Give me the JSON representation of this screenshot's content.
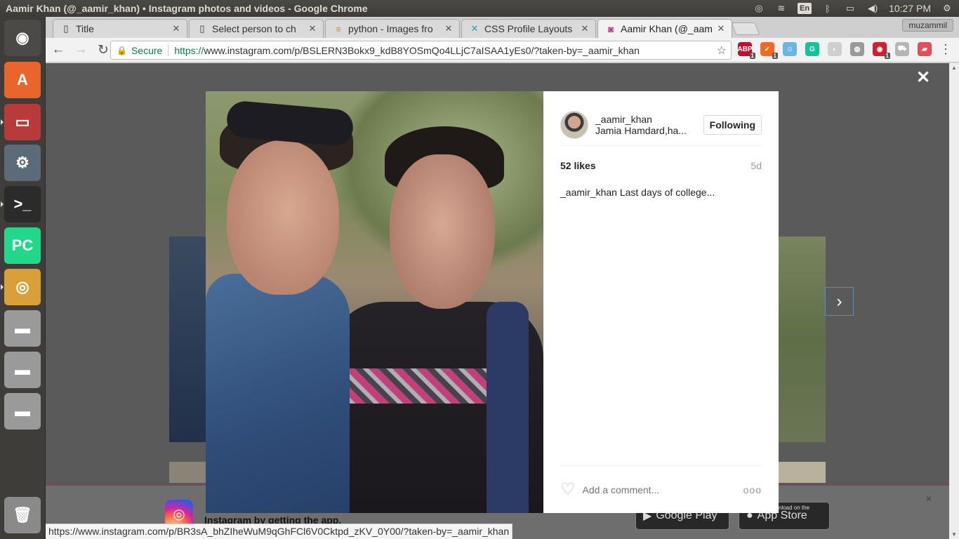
{
  "os": {
    "window_title": "Aamir Khan (@_aamir_khan) • Instagram photos and videos - Google Chrome",
    "lang": "En",
    "clock": "10:27 PM",
    "tray_icons": [
      "chrome-icon",
      "wifi-icon",
      "keyboard-lang",
      "bluetooth-icon",
      "battery-icon",
      "volume-icon",
      "clock",
      "settings-gear-icon"
    ]
  },
  "launcher": {
    "items": [
      {
        "name": "ubuntu-dash-icon",
        "glyph": "◉",
        "color": "#4b4a46"
      },
      {
        "name": "software-center-icon",
        "glyph": "A",
        "color": "#e8652b"
      },
      {
        "name": "file-manager-icon",
        "glyph": "▭",
        "color": "#b83a3a"
      },
      {
        "name": "system-settings-icon",
        "glyph": "⚙",
        "color": "#5c6b7a"
      },
      {
        "name": "terminal-icon",
        "glyph": ">_",
        "color": "#2b2b2b"
      },
      {
        "name": "pycharm-icon",
        "glyph": "PC",
        "color": "#21d789"
      },
      {
        "name": "chrome-icon",
        "glyph": "◎",
        "color": "#d9a03a"
      },
      {
        "name": "drive-icon-1",
        "glyph": "▬",
        "color": "#9a9a9a"
      },
      {
        "name": "drive-icon-2",
        "glyph": "▬",
        "color": "#9a9a9a"
      },
      {
        "name": "drive-icon-3",
        "glyph": "▬",
        "color": "#9a9a9a"
      },
      {
        "name": "trash-icon",
        "glyph": "🗑",
        "color": "#8a8a8a"
      }
    ]
  },
  "browser": {
    "tabs": [
      {
        "label": "Title",
        "icon": "page-icon",
        "active": false
      },
      {
        "label": "Select person to ch",
        "icon": "page-icon",
        "active": false
      },
      {
        "label": "python - Images fro",
        "icon": "stackoverflow-icon",
        "active": false
      },
      {
        "label": "CSS Profile Layouts",
        "icon": "codepen-icon",
        "active": false
      },
      {
        "label": "Aamir Khan (@_aam",
        "icon": "instagram-icon",
        "active": true
      }
    ],
    "profile_name": "muzammil",
    "secure_label": "Secure",
    "url_proto": "https://",
    "url_rest": "www.instagram.com/p/BSLERN3Bokx9_kdB8YOSmQo4LLjC7aISAA1yEs0/?taken-by=_aamir_khan",
    "extensions": [
      {
        "name": "adblock-icon",
        "text": "ABP",
        "color": "#c70d2c",
        "badge": "1"
      },
      {
        "name": "extension-icon-2",
        "text": "✓",
        "color": "#f06b1f",
        "badge": "1"
      },
      {
        "name": "extension-icon-3",
        "text": "☺",
        "color": "#6cb4e4",
        "badge": ""
      },
      {
        "name": "grammarly-icon",
        "text": "G",
        "color": "#15c39a",
        "badge": ""
      },
      {
        "name": "extension-icon-5",
        "text": "◐",
        "color": "#cfcfcf",
        "badge": ""
      },
      {
        "name": "globe-icon",
        "text": "◍",
        "color": "#9a9a9a",
        "badge": ""
      },
      {
        "name": "extension-icon-7",
        "text": "◉",
        "color": "#d0202f",
        "badge": "1"
      },
      {
        "name": "cart-icon",
        "text": "⛟",
        "color": "#b5b5b5",
        "badge": ""
      },
      {
        "name": "extension-icon-9",
        "text": "▰",
        "color": "#e0505a",
        "badge": ""
      }
    ],
    "status_url": "https://www.instagram.com/p/BR3sA_bhZIheWuM9qGhFCl6V0Cktpd_zKV_0Y00/?taken-by=_aamir_khan"
  },
  "post": {
    "username": "_aamir_khan",
    "location": "Jamia Hamdard,ha...",
    "follow_label": "Following",
    "likes": "52 likes",
    "ago": "5d",
    "caption_user": "_aamir_khan",
    "caption_text": "Last days of college...",
    "comment_placeholder": "Add a comment...",
    "more": "ooo"
  },
  "footer": {
    "text": "Instagram by getting the app.",
    "google_play": "Google Play",
    "app_store": "App Store",
    "app_store_small": "Download on the"
  },
  "lightbox": {
    "close": "✕",
    "next": "›"
  }
}
